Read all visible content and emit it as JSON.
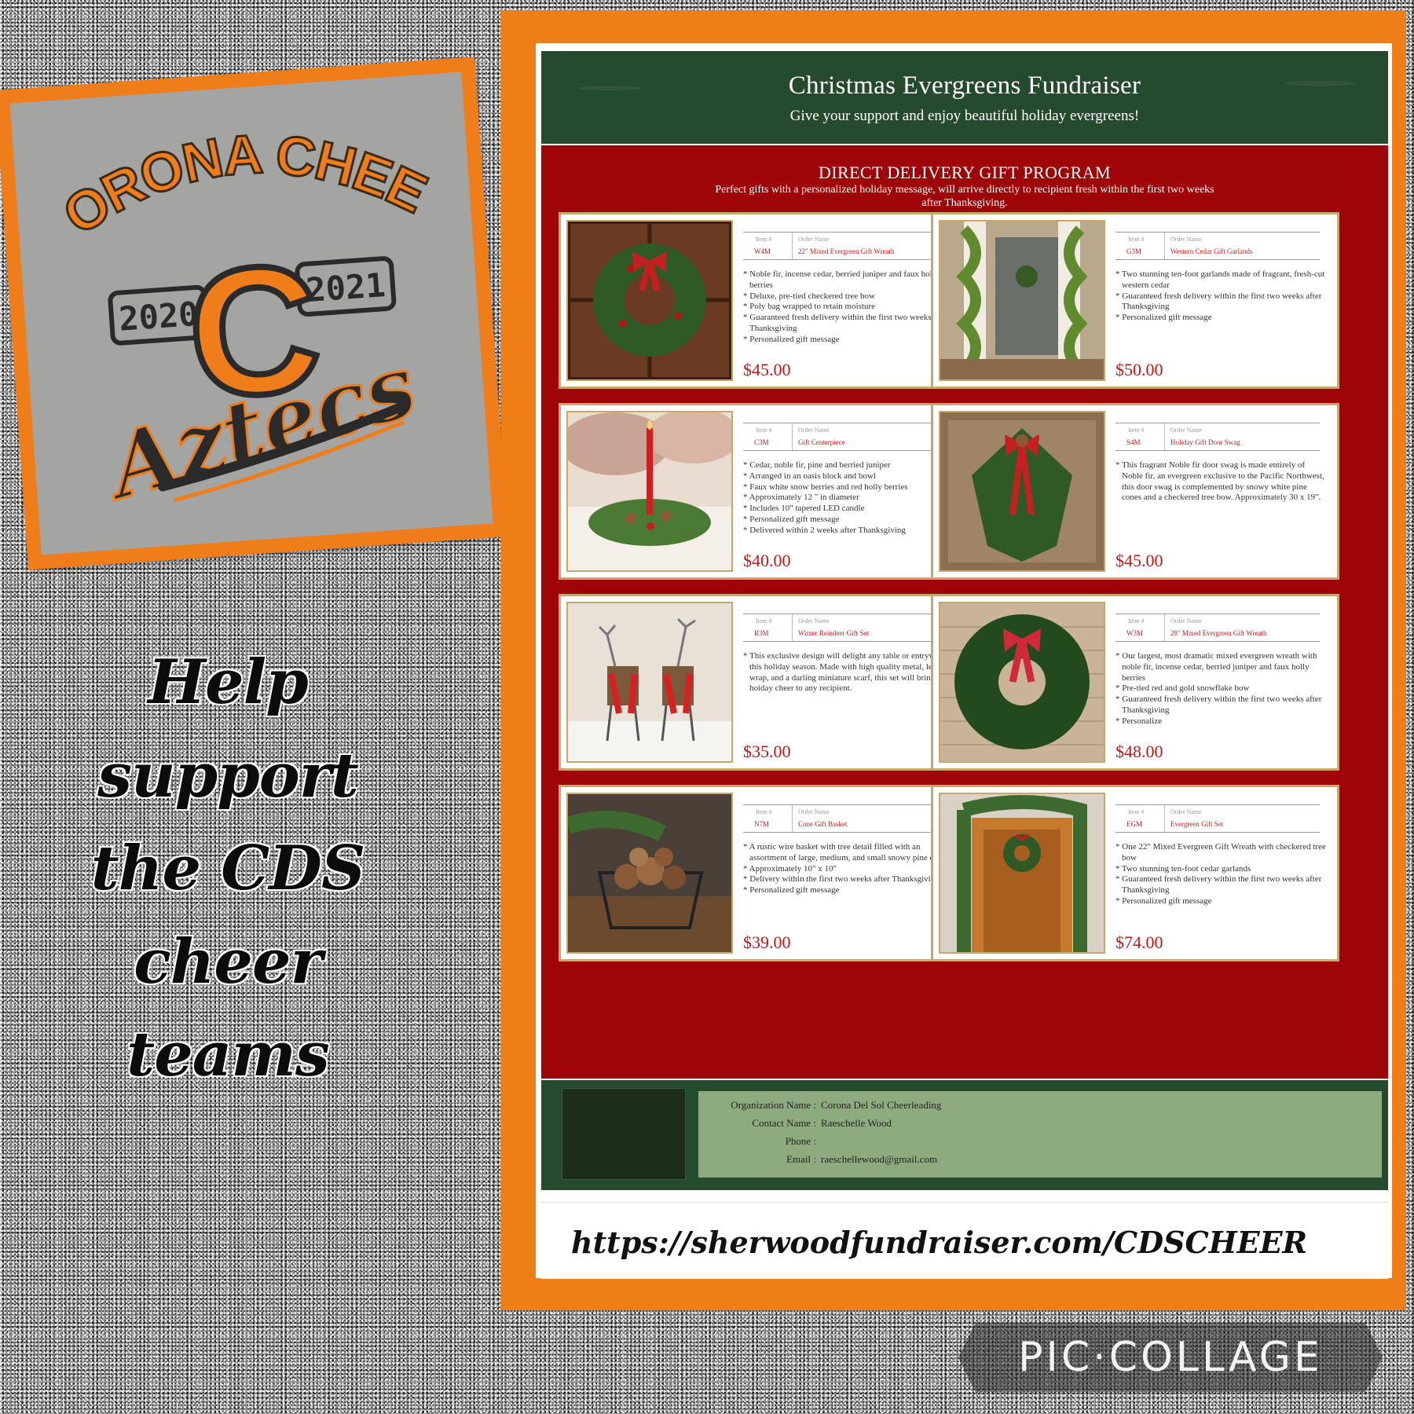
{
  "logo": {
    "top_text": "CORONA CHEER",
    "letter": "C",
    "year_left": "2020",
    "year_right": "2021",
    "script_text": "Aztecs",
    "colors": {
      "orange": "#ee7d1a",
      "gray": "#a4a4a2",
      "dark": "#2a2a2a"
    }
  },
  "help_text": [
    "Help",
    "support",
    "the CDS",
    "cheer",
    "teams"
  ],
  "flyer": {
    "title": "Christmas Evergreens Fundraiser",
    "subtitle": "Give your support and enjoy beautiful holiday evergreens!",
    "program_title": "DIRECT DELIVERY GIFT PROGRAM",
    "program_desc": "Perfect gifts with a personalized holiday message, will arrive directly to recipient fresh within the first two weeks after Thanksgiving.",
    "item_label": "Item #",
    "order_label": "Order Name",
    "products": [
      {
        "item": "W4M",
        "name": "22\" Mixed Evergreen Gift Wreath",
        "price": "$45.00",
        "desc": [
          "* Noble fir, incense cedar, berried juniper and faux holly berries",
          "* Deluxe, pre-tied checkered tree bow",
          "* Poly bag wrapped to retain moisture",
          "* Guaranteed fresh delivery within the first two weeks after Thanksgiving",
          "* Personalized gift message"
        ]
      },
      {
        "item": "G3M",
        "name": "Western Cedar Gift Garlands",
        "price": "$50.00",
        "desc": [
          "* Two stunning ten-foot garlands made of fragrant, fresh-cut western cedar",
          "* Guaranteed fresh delivery within the first two weeks after Thanksgiving",
          "* Personalized gift message"
        ]
      },
      {
        "item": "C3M",
        "name": "Gift Centerpiece",
        "price": "$40.00",
        "desc": [
          "* Cedar, noble fir, pine and berried juniper",
          "* Arranged in an oasis block and bowl",
          "* Faux white snow berries and red holly berries",
          "* Approximately 12 \" in diameter",
          "* Includes 10\" tapered LED candle",
          "* Personalized gift message",
          "* Delivered within 2 weeks after Thanksgiving"
        ]
      },
      {
        "item": "S4M",
        "name": "Holiday Gift Door Swag",
        "price": "$45.00",
        "desc": [
          "* This fragrant Noble fir door swag is made entirely of Noble fir, an evergreen exclusive to the Pacific Northwest, this door swag is complemented by snowy white pine cones and a checkered tree bow. Approximately 30 x 19\"."
        ]
      },
      {
        "item": "R3M",
        "name": "Winter Reindeer Gift Set",
        "price": "$35.00",
        "desc": [
          "* This exclusive design will delight any table or entryway this holiday season. Made with high quality metal, leather wrap, and a darling miniature scarf, this set will bring hoiday cheer to any recipient."
        ]
      },
      {
        "item": "W3M",
        "name": "28\" Mixed Evergreen Gift Wreath",
        "price": "$48.00",
        "desc": [
          "* Our largest, most dramatic mixed evergreen wreath with noble fir, incense cedar, berried juniper and faux holly berries",
          "* Pre-tied red and gold snowflake bow",
          "* Guaranteed fresh delivery within the first two weeks after Thanksgiving",
          "* Personalize"
        ]
      },
      {
        "item": "N7M",
        "name": "Cone Gift Basket",
        "price": "$39.00",
        "desc": [
          "* A rustic wire basket with tree detail filled with an assortment of large, medium, and small snowy pine cones",
          "* Approximately 10\" x 10\"",
          "* Delivery within the first two weeks after Thanksgiving",
          "* Personalized gift message"
        ]
      },
      {
        "item": "EGM",
        "name": "Evergreen Gift Set",
        "price": "$74.00",
        "desc": [
          "* One 22\" Mixed Evergreen Gift Wreath with checkered tree bow",
          "* Two stunning ten-foot cedar garlands",
          "* Guaranteed fresh delivery within the first two weeks after Thanksgiving",
          "* Personalized gift message"
        ]
      }
    ],
    "contact": {
      "org_label": "Organization Name :",
      "org_value": "Corona Del Sol Cheerleading",
      "contact_label": "Contact Name :",
      "contact_value": "Raeschelle Wood",
      "phone_label": "Phone :",
      "phone_value": "",
      "email_label": "Email :",
      "email_value": "raeschellewood@gmail.com"
    },
    "url": "https://sherwoodfundraiser.com/CDSCHEER",
    "colors": {
      "frame": "#f07e16",
      "header_green": "#264a2e",
      "red": "#9e0508",
      "info_green": "#8eab7f",
      "price_red": "#c01818"
    }
  },
  "watermark": "PIC·COLLAGE"
}
